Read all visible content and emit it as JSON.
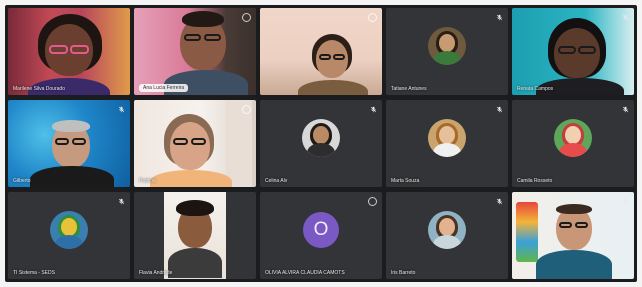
{
  "participants": [
    {
      "id": "p1",
      "name": "Marilene Silva Dourado",
      "type": "video",
      "scene": "colorful-wall",
      "mic": "none",
      "label_style": "plain"
    },
    {
      "id": "p2",
      "name": "Ana Lucia Ferreira",
      "type": "video",
      "scene": "pink-wall",
      "mic": "ring",
      "label_style": "pill"
    },
    {
      "id": "p3",
      "name": "",
      "type": "video",
      "scene": "cream-room",
      "mic": "ring",
      "label_style": "plain"
    },
    {
      "id": "p4",
      "name": "Tatiane Antunes",
      "type": "avatar",
      "mic": "muted",
      "label_style": "plain",
      "avatar_colors": {
        "bg": "#6e5a3e",
        "hair": "#2a1d12",
        "skin": "#c79a73",
        "body": "#3c7a3c"
      }
    },
    {
      "id": "p5",
      "name": "Renata Campos",
      "type": "video",
      "scene": "teal-wall",
      "mic": "muted",
      "label_style": "plain"
    },
    {
      "id": "p6",
      "name": "Gilberto",
      "type": "video",
      "scene": "blue-water",
      "mic": "muted",
      "label_style": "plain"
    },
    {
      "id": "p7",
      "name": "Patricia",
      "type": "video",
      "scene": "white-door",
      "mic": "ring",
      "label_style": "plain"
    },
    {
      "id": "p8",
      "name": "Celina Alv",
      "type": "avatar",
      "mic": "muted",
      "label_style": "plain",
      "avatar_colors": {
        "bg": "#d8d8d8",
        "hair": "#1e1a18",
        "skin": "#b98a64",
        "body": "#2d2d2d"
      }
    },
    {
      "id": "p9",
      "name": "Marta Souza",
      "type": "avatar",
      "mic": "muted",
      "label_style": "plain",
      "avatar_colors": {
        "bg": "#c9a46d",
        "hair": "#a86a2b",
        "skin": "#e6c09a",
        "body": "#f0f0f0"
      }
    },
    {
      "id": "p10",
      "name": "Camila Rosseto",
      "type": "avatar",
      "mic": "muted",
      "label_style": "plain",
      "avatar_colors": {
        "bg": "#5fa55a",
        "hair": "#c43c3c",
        "skin": "#f0d0b0",
        "body": "#e84b4b"
      }
    },
    {
      "id": "p11",
      "name": "TI Sistema - SEDS",
      "type": "avatar",
      "mic": "muted",
      "label_style": "plain",
      "avatar_colors": {
        "bg": "#3a7fb0",
        "hair": "#2f8f3f",
        "skin": "#e9c23a",
        "body": "#2f6fa8"
      }
    },
    {
      "id": "p12",
      "name": "Flavia Andrade",
      "type": "video",
      "scene": "white-wall",
      "mic": "none",
      "label_style": "plain"
    },
    {
      "id": "p13",
      "name": "OLIVIA ALVIRA CLAUDIA CAMOTS",
      "type": "letter",
      "letter": "O",
      "mic": "ring",
      "label_style": "plain"
    },
    {
      "id": "p14",
      "name": "Iris Barreto",
      "type": "avatar",
      "mic": "muted",
      "label_style": "plain",
      "avatar_colors": {
        "bg": "#8fb2c4",
        "hair": "#4a3322",
        "skin": "#e2b38e",
        "body": "#c9d6dc"
      }
    },
    {
      "id": "p15",
      "name": "",
      "type": "video",
      "scene": "colorful-office",
      "mic": "muted",
      "label_style": "plain"
    }
  ]
}
